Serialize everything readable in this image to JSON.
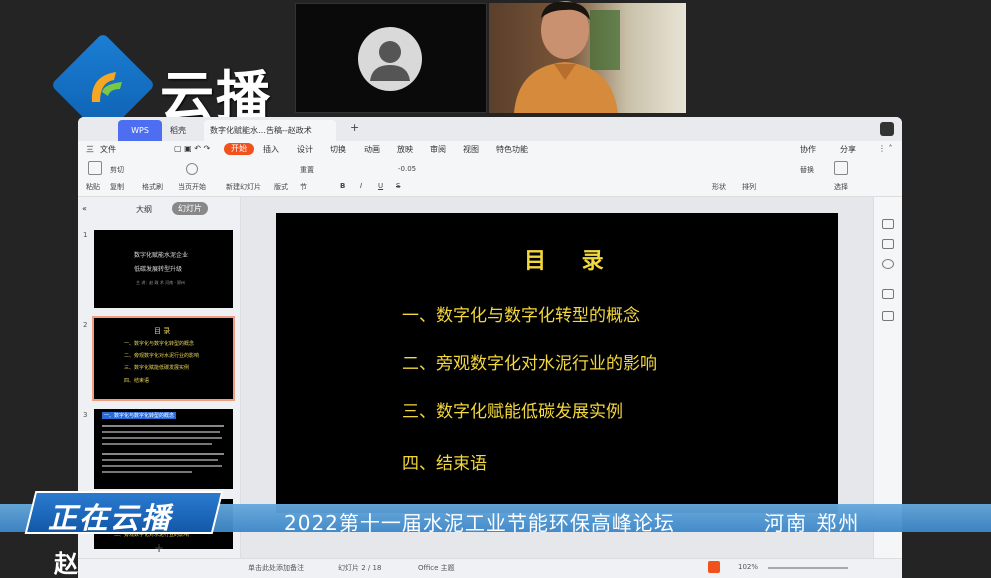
{
  "logo": {
    "text": "云播"
  },
  "window": {
    "tabs": [
      {
        "label": "WPS"
      },
      {
        "label": "稻壳"
      },
      {
        "label": "数字化赋能水…告稿--赵政术"
      }
    ],
    "new_tab": "+",
    "menus": [
      "三",
      "文件",
      "开始",
      "插入",
      "设计",
      "切换",
      "动画",
      "放映",
      "审阅",
      "视图",
      "特色功能"
    ],
    "share_labels": [
      "协作",
      "分享"
    ],
    "ribbon": {
      "paste": "粘贴",
      "cut": "剪切",
      "copy": "复制",
      "format_painter": "格式刷",
      "current_start": "当页开始",
      "new_slide": "新建幻灯片",
      "layout": "版式",
      "section": "节",
      "reset": "重置",
      "font_size": "-0.05",
      "bold": "B",
      "italic": "I",
      "underline": "U",
      "strike": "S",
      "shapes": "形状",
      "arrange": "排列",
      "select": "选择",
      "replace": "替换"
    },
    "sidebar": {
      "tab_outline": "大纲",
      "tab_slides": "幻灯片",
      "slide1": {
        "num": "1",
        "title1": "数字化赋能水泥企业",
        "title2": "低碳发展转型升级",
        "sub": "主 讲：赵 政 术   河南 · 郑州"
      },
      "slide2": {
        "num": "2",
        "title": "目 录",
        "items": [
          "一、数字化与数字化转型的概念",
          "二、旁观数字化对水泥行业的影响",
          "三、数字化赋能低碳发展实例",
          "四、结束语"
        ]
      },
      "slide3": {
        "num": "3",
        "header": "一、数字化与数字化转型的概念"
      },
      "slide4_header": "二、旁观数字化对水泥行业的影响",
      "add": "+"
    },
    "slide": {
      "title": "目 录",
      "items": [
        "一、数字化与数字化转型的概念",
        "二、旁观数字化对水泥行业的影响",
        "三、数字化赋能低碳发展实例",
        "四、结束语"
      ]
    },
    "statusbar": {
      "notes": "单击此处添加备注",
      "slide_info": "幻灯片 2 / 18",
      "theme": "Office 主题",
      "zoom": "102%"
    }
  },
  "banner": {
    "badge": "正在云播",
    "title": "2022第十一届水泥工业节能环保高峰论坛",
    "location": "河南  郑州",
    "name_char": "赵"
  },
  "colors": {
    "slide_text": "#f2d73d",
    "accent": "#f0511d",
    "brand_blue": "#2a7bd0"
  }
}
